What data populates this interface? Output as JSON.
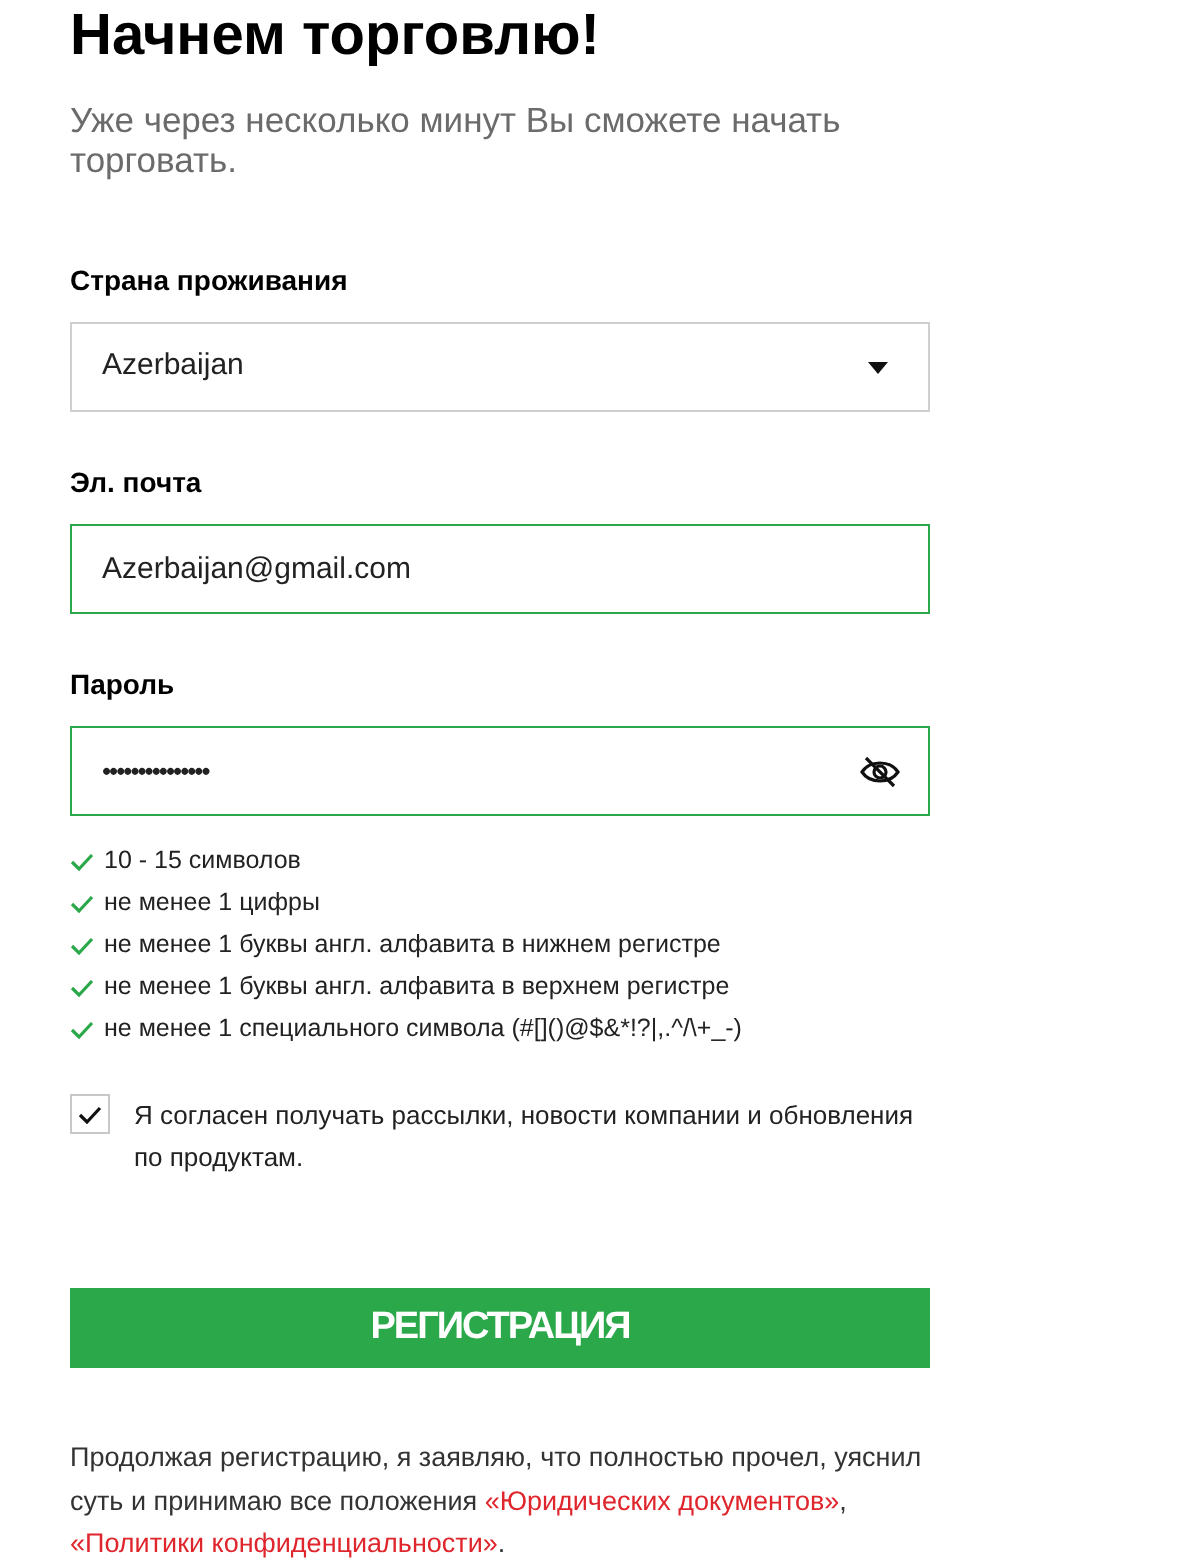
{
  "title": "Начнем торговлю!",
  "subtitle": "Уже через несколько минут Вы сможете начать торговать.",
  "fields": [
    {
      "kind": "select",
      "label": "Страна проживания",
      "value": "Azerbaijan",
      "valid": false
    },
    {
      "kind": "text",
      "label": "Эл. почта",
      "value": "Azerbaijan@gmail.com",
      "valid": true
    },
    {
      "kind": "password",
      "label": "Пароль",
      "value": "•••••••••••••••",
      "valid": true,
      "masked": true
    }
  ],
  "rules": [
    {
      "text": "10 - 15 символов",
      "met": true
    },
    {
      "text": "не менее 1 цифры",
      "met": true
    },
    {
      "text": "не менее 1 буквы англ. алфавита в нижнем регистре",
      "met": true
    },
    {
      "text": "не менее 1 буквы англ. алфавита в верхнем регистре",
      "met": true
    },
    {
      "text": "не менее 1 специального символа (#[]()@$&*!?|,.^/\\+_-)",
      "met": true
    }
  ],
  "consent": {
    "text": "Я согласен получать рассылки, новости компании и обновления по продуктам.",
    "checked": true
  },
  "submit": "РЕГИСТРАЦИЯ",
  "footer": [
    {
      "kind": "text",
      "text": "Продолжая регистрацию, я заявляю, что полностью прочел, уяснил суть и принимаю все положения "
    },
    {
      "kind": "link",
      "text": "«Юридических документов»"
    },
    {
      "kind": "text",
      "text": ", "
    },
    {
      "kind": "link",
      "text": "«Политики конфиденциальности»"
    },
    {
      "kind": "text",
      "text": "."
    }
  ]
}
